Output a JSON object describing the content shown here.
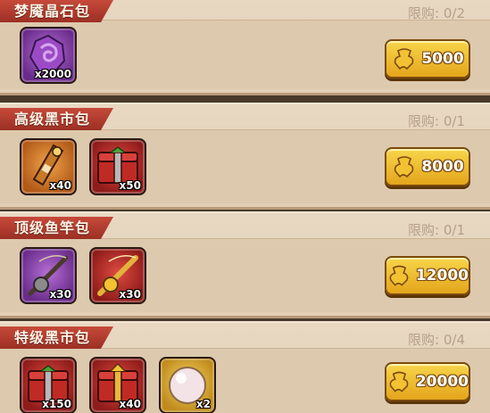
{
  "packs": [
    {
      "title": "梦魇晶石包",
      "limit": "限购: 0/2",
      "price": "5000",
      "items": [
        {
          "name": "purple-crystal-icon",
          "qty": "x2000",
          "color": "purple"
        }
      ]
    },
    {
      "title": "高级黑市包",
      "limit": "限购: 0/1",
      "price": "8000",
      "items": [
        {
          "name": "key-token-icon",
          "qty": "x40",
          "color": "orange"
        },
        {
          "name": "red-chest-icon",
          "qty": "x50",
          "color": "red"
        }
      ]
    },
    {
      "title": "顶级鱼竿包",
      "limit": "限购: 0/1",
      "price": "12000",
      "items": [
        {
          "name": "fishing-rod-icon",
          "qty": "x30",
          "color": "purple"
        },
        {
          "name": "golden-fishing-rod-icon",
          "qty": "x30",
          "color": "red"
        }
      ]
    },
    {
      "title": "特级黑市包",
      "limit": "限购: 0/4",
      "price": "20000",
      "items": [
        {
          "name": "red-chest-icon",
          "qty": "x150",
          "color": "red"
        },
        {
          "name": "golden-chest-icon",
          "qty": "x40",
          "color": "red"
        },
        {
          "name": "pearl-icon",
          "qty": "x2",
          "color": "gold"
        }
      ]
    }
  ]
}
